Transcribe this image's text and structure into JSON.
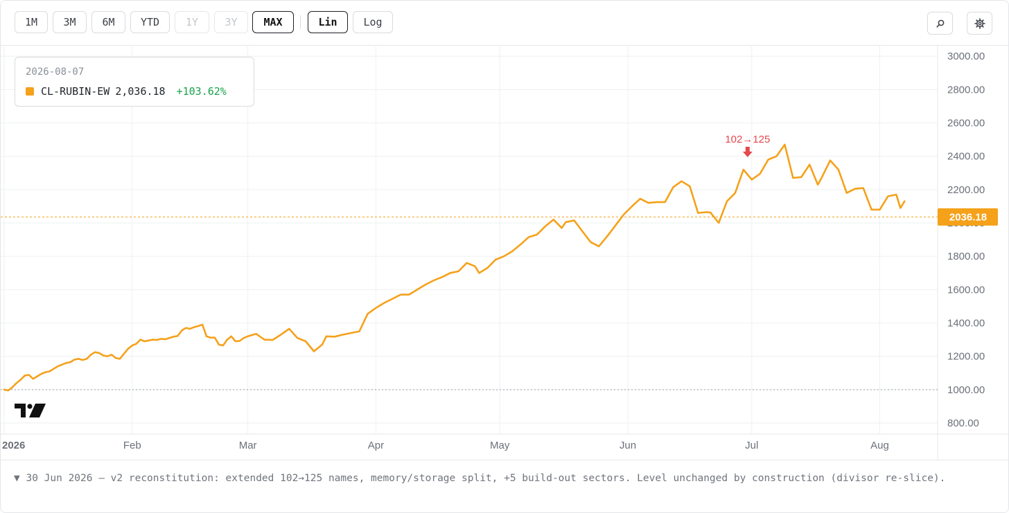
{
  "toolbar": {
    "ranges": [
      {
        "label": "1M",
        "state": "enabled"
      },
      {
        "label": "3M",
        "state": "enabled"
      },
      {
        "label": "6M",
        "state": "enabled"
      },
      {
        "label": "YTD",
        "state": "enabled"
      },
      {
        "label": "1Y",
        "state": "disabled"
      },
      {
        "label": "3Y",
        "state": "disabled"
      },
      {
        "label": "MAX",
        "state": "active"
      }
    ],
    "scales": [
      {
        "label": "Lin",
        "state": "active"
      },
      {
        "label": "Log",
        "state": "enabled"
      }
    ],
    "icons": [
      "search-icon",
      "gear-icon"
    ]
  },
  "legend": {
    "date": "2026-08-07",
    "series_name": "CL-RUBIN-EW",
    "value": "2,036.18",
    "change": "+103.62%"
  },
  "footer": {
    "note": "▼ 30 Jun 2026 — v2 reconstitution: extended 102→125 names, memory/storage split, +5 build-out sectors. Level unchanged by construction (divisor re-slice)."
  },
  "colors": {
    "line": "#f5a11a",
    "annotation": "#e5484d",
    "baseline": "#9aa0a6",
    "positive": "#16a34a"
  },
  "chart_data": {
    "type": "line",
    "x_start": "2026-01-01",
    "x_end": "2026-08-07",
    "x_tick_labels": [
      "2026",
      "Feb",
      "Mar",
      "Apr",
      "May",
      "Jun",
      "Jul",
      "Aug"
    ],
    "y_tick_labels": [
      "800.00",
      "1000.00",
      "1200.00",
      "1400.00",
      "1600.00",
      "1800.00",
      "2000.00",
      "2200.00",
      "2400.00",
      "2600.00",
      "2800.00",
      "3000.00"
    ],
    "ylim": [
      750,
      3080
    ],
    "scale": "linear",
    "grid": true,
    "baseline": 1000,
    "last_value_label": "2036.18",
    "annotation": {
      "date": "2026-06-30",
      "label": "102→125"
    },
    "series": [
      {
        "color": "#f5a11a",
        "points": [
          [
            "2026-01-01",
            1000
          ],
          [
            "2026-01-02",
            995
          ],
          [
            "2026-01-03",
            1015
          ],
          [
            "2026-01-04",
            1040
          ],
          [
            "2026-01-05",
            1060
          ],
          [
            "2026-01-06",
            1085
          ],
          [
            "2026-01-07",
            1088
          ],
          [
            "2026-01-08",
            1065
          ],
          [
            "2026-01-09",
            1080
          ],
          [
            "2026-01-10",
            1095
          ],
          [
            "2026-01-11",
            1105
          ],
          [
            "2026-01-12",
            1110
          ],
          [
            "2026-01-13",
            1125
          ],
          [
            "2026-01-14",
            1140
          ],
          [
            "2026-01-15",
            1150
          ],
          [
            "2026-01-16",
            1160
          ],
          [
            "2026-01-17",
            1165
          ],
          [
            "2026-01-18",
            1180
          ],
          [
            "2026-01-19",
            1185
          ],
          [
            "2026-01-20",
            1178
          ],
          [
            "2026-01-21",
            1185
          ],
          [
            "2026-01-22",
            1210
          ],
          [
            "2026-01-23",
            1225
          ],
          [
            "2026-01-24",
            1220
          ],
          [
            "2026-01-25",
            1205
          ],
          [
            "2026-01-26",
            1200
          ],
          [
            "2026-01-27",
            1210
          ],
          [
            "2026-01-28",
            1190
          ],
          [
            "2026-01-29",
            1185
          ],
          [
            "2026-01-30",
            1215
          ],
          [
            "2026-01-31",
            1245
          ],
          [
            "2026-02-01",
            1265
          ],
          [
            "2026-02-02",
            1275
          ],
          [
            "2026-02-03",
            1300
          ],
          [
            "2026-02-04",
            1290
          ],
          [
            "2026-02-05",
            1295
          ],
          [
            "2026-02-06",
            1300
          ],
          [
            "2026-02-07",
            1298
          ],
          [
            "2026-02-08",
            1305
          ],
          [
            "2026-02-09",
            1302
          ],
          [
            "2026-02-10",
            1310
          ],
          [
            "2026-02-11",
            1318
          ],
          [
            "2026-02-12",
            1322
          ],
          [
            "2026-02-13",
            1355
          ],
          [
            "2026-02-14",
            1370
          ],
          [
            "2026-02-15",
            1365
          ],
          [
            "2026-02-16",
            1375
          ],
          [
            "2026-02-17",
            1382
          ],
          [
            "2026-02-18",
            1390
          ],
          [
            "2026-02-19",
            1320
          ],
          [
            "2026-02-20",
            1312
          ],
          [
            "2026-02-21",
            1312
          ],
          [
            "2026-02-22",
            1270
          ],
          [
            "2026-02-23",
            1265
          ],
          [
            "2026-02-24",
            1300
          ],
          [
            "2026-02-25",
            1320
          ],
          [
            "2026-02-26",
            1290
          ],
          [
            "2026-02-27",
            1292
          ],
          [
            "2026-02-28",
            1310
          ],
          [
            "2026-03-01",
            1320
          ],
          [
            "2026-03-03",
            1335
          ],
          [
            "2026-03-05",
            1300
          ],
          [
            "2026-03-07",
            1298
          ],
          [
            "2026-03-09",
            1330
          ],
          [
            "2026-03-11",
            1365
          ],
          [
            "2026-03-13",
            1310
          ],
          [
            "2026-03-15",
            1290
          ],
          [
            "2026-03-17",
            1230
          ],
          [
            "2026-03-19",
            1270
          ],
          [
            "2026-03-20",
            1320
          ],
          [
            "2026-03-22",
            1318
          ],
          [
            "2026-03-24",
            1330
          ],
          [
            "2026-03-26",
            1340
          ],
          [
            "2026-03-28",
            1350
          ],
          [
            "2026-03-30",
            1455
          ],
          [
            "2026-04-01",
            1490
          ],
          [
            "2026-04-03",
            1520
          ],
          [
            "2026-04-05",
            1545
          ],
          [
            "2026-04-07",
            1570
          ],
          [
            "2026-04-09",
            1570
          ],
          [
            "2026-04-11",
            1600
          ],
          [
            "2026-04-13",
            1630
          ],
          [
            "2026-04-15",
            1655
          ],
          [
            "2026-04-17",
            1675
          ],
          [
            "2026-04-19",
            1700
          ],
          [
            "2026-04-21",
            1710
          ],
          [
            "2026-04-23",
            1760
          ],
          [
            "2026-04-25",
            1740
          ],
          [
            "2026-04-26",
            1700
          ],
          [
            "2026-04-28",
            1730
          ],
          [
            "2026-04-30",
            1780
          ],
          [
            "2026-05-02",
            1800
          ],
          [
            "2026-05-04",
            1830
          ],
          [
            "2026-05-06",
            1870
          ],
          [
            "2026-05-08",
            1915
          ],
          [
            "2026-05-10",
            1930
          ],
          [
            "2026-05-12",
            1980
          ],
          [
            "2026-05-14",
            2020
          ],
          [
            "2026-05-16",
            1970
          ],
          [
            "2026-05-17",
            2005
          ],
          [
            "2026-05-19",
            2015
          ],
          [
            "2026-05-21",
            1950
          ],
          [
            "2026-05-23",
            1885
          ],
          [
            "2026-05-25",
            1860
          ],
          [
            "2026-05-27",
            1920
          ],
          [
            "2026-05-29",
            1985
          ],
          [
            "2026-05-31",
            2050
          ],
          [
            "2026-06-02",
            2100
          ],
          [
            "2026-06-04",
            2145
          ],
          [
            "2026-06-06",
            2120
          ],
          [
            "2026-06-08",
            2125
          ],
          [
            "2026-06-10",
            2125
          ],
          [
            "2026-06-12",
            2215
          ],
          [
            "2026-06-14",
            2250
          ],
          [
            "2026-06-16",
            2220
          ],
          [
            "2026-06-18",
            2060
          ],
          [
            "2026-06-20",
            2065
          ],
          [
            "2026-06-21",
            2063
          ],
          [
            "2026-06-23",
            2000
          ],
          [
            "2026-06-25",
            2130
          ],
          [
            "2026-06-27",
            2180
          ],
          [
            "2026-06-29",
            2320
          ],
          [
            "2026-07-01",
            2260
          ],
          [
            "2026-07-03",
            2295
          ],
          [
            "2026-07-05",
            2380
          ],
          [
            "2026-07-07",
            2400
          ],
          [
            "2026-07-09",
            2470
          ],
          [
            "2026-07-11",
            2270
          ],
          [
            "2026-07-13",
            2275
          ],
          [
            "2026-07-15",
            2350
          ],
          [
            "2026-07-17",
            2230
          ],
          [
            "2026-07-18",
            2275
          ],
          [
            "2026-07-20",
            2375
          ],
          [
            "2026-07-22",
            2320
          ],
          [
            "2026-07-24",
            2180
          ],
          [
            "2026-07-26",
            2205
          ],
          [
            "2026-07-28",
            2210
          ],
          [
            "2026-07-30",
            2080
          ],
          [
            "2026-08-01",
            2080
          ],
          [
            "2026-08-03",
            2160
          ],
          [
            "2026-08-05",
            2170
          ],
          [
            "2026-08-06",
            2090
          ],
          [
            "2026-08-07",
            2130
          ]
        ]
      }
    ]
  }
}
